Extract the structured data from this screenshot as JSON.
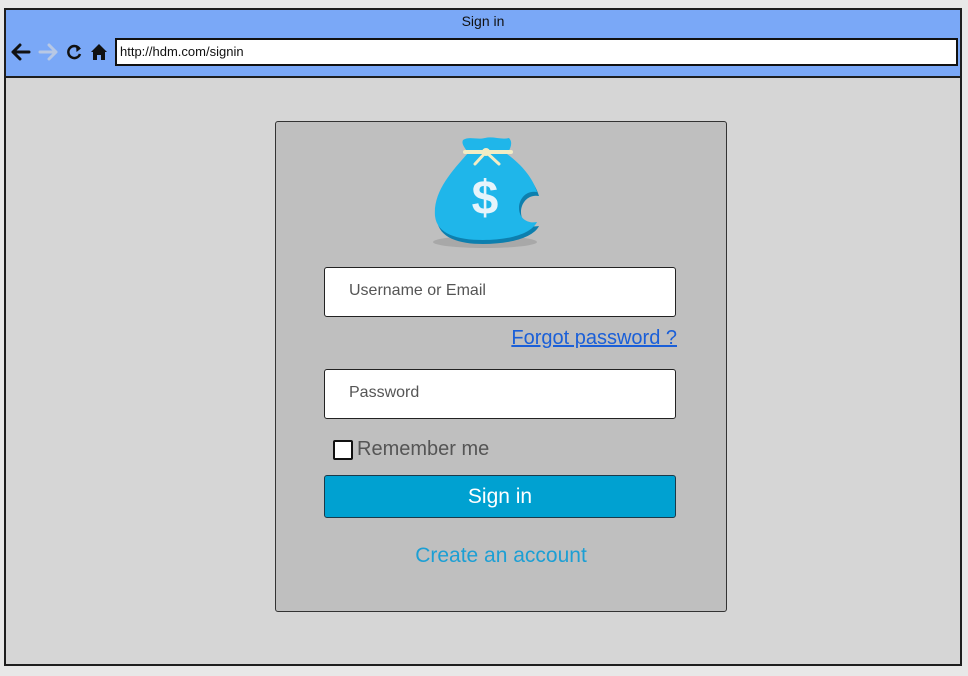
{
  "window": {
    "title": "Sign in"
  },
  "browser": {
    "url": "http://hdm.com/signin",
    "nav_icons": [
      "back-arrow-icon",
      "forward-arrow-icon",
      "reload-icon",
      "home-icon"
    ]
  },
  "login": {
    "logo_icon": "money-bag-icon",
    "logo_symbol": "$",
    "username_placeholder": "Username or Email",
    "forgot_password": "Forgot password ?",
    "password_placeholder": "Password",
    "remember_me": "Remember me",
    "remember_checked": false,
    "sign_in": "Sign in",
    "create_account": "Create an account"
  },
  "colors": {
    "browser_bar": "#7aa8f7",
    "page_background": "#d6d6d6",
    "card_background": "#bfbfbf",
    "primary_button": "#00a1d1",
    "link_blue": "#1a5fd8",
    "create_link": "#1c9fd4",
    "logo_blue": "#1fb6ea"
  }
}
